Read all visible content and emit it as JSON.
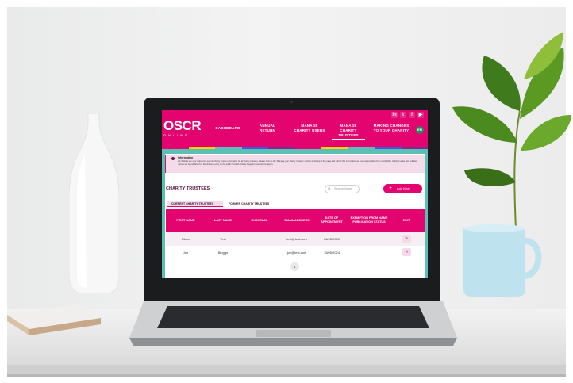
{
  "header": {
    "logo_main": "OSCR",
    "logo_sub": "ONLINE",
    "nav": [
      {
        "label": "DASHBOARD"
      },
      {
        "label": "ANNUAL RETURN"
      },
      {
        "label": "MANAGE CHARITY USERS"
      },
      {
        "label": "MANAGE CHARITY TRUSTEES"
      },
      {
        "label": "MAKING CHANGES TO YOUR CHARITY"
      }
    ],
    "avatar_initials": "EM",
    "social": [
      {
        "icon": "linkedin-icon",
        "glyph": "in"
      },
      {
        "icon": "twitter-icon",
        "glyph": "t"
      },
      {
        "icon": "facebook-icon",
        "glyph": "f"
      },
      {
        "icon": "youtube-icon",
        "glyph": "▶"
      }
    ]
  },
  "info": {
    "title": "Information",
    "body": "All charities are now required to submit charity trustee information for all charity trustees. Please click on the 'Manage your charity trustees' section at the top of the page and submit this information as soon as possible. From early 2026, charity trustee first and last names will be published on the charity's entry on the public Scottish Charity Register (exemptions apply)."
  },
  "page": {
    "title": "CHARITY TRUSTEES",
    "search_placeholder": "Search Name",
    "add_label": "Add New",
    "tabs": [
      "CURRENT CHARITY TRUSTEES",
      "FORMER CHARITY TRUSTEES"
    ]
  },
  "table": {
    "headers": [
      "FIRST NAME",
      "LAST NAME",
      "KNOWN AS",
      "EMAIL ADDRESS",
      "DATE OF APPOINTMENT",
      "EXEMPTION FROM NAME PUBLICATION STATUS",
      "EDIT"
    ],
    "rows": [
      [
        "Claire",
        "Test",
        "",
        "test@test.com",
        "06/05/2000",
        ""
      ],
      [
        "Joe",
        "Bloggs",
        "",
        "joe@test.com",
        "15/05/2024",
        ""
      ]
    ]
  },
  "pagination": {
    "current": "1"
  },
  "colors": {
    "brand": "#e4046f",
    "teal": "#5bbfb5",
    "tint": "#f3dbe9",
    "stripes": [
      "#e4046f",
      "#ffd300",
      "#5bbfb5",
      "#3b5bdb",
      "#7a2d8c",
      "#e4046f",
      "#ffd300",
      "#5bbfb5",
      "#3b5bdb",
      "#7a2d8c"
    ]
  }
}
